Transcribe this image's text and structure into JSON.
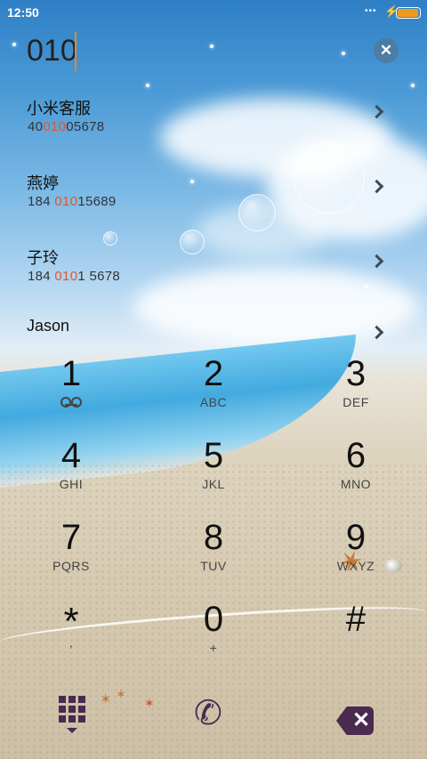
{
  "status_bar": {
    "time": "12:50",
    "signal_dots": "•••",
    "battery_level": 0.95,
    "battery_color": "#f09a1c"
  },
  "dialer": {
    "typed_number": "010",
    "clear_icon": "close-icon",
    "caret_color": "#e08a2a"
  },
  "results": [
    {
      "name": "小米客服",
      "number_pre": "40",
      "number_match": "010",
      "number_post": "05678"
    },
    {
      "name": "燕婷",
      "number_pre": "184 ",
      "number_match": "010",
      "number_post": "15689"
    },
    {
      "name": "子玲",
      "number_pre": "184 ",
      "number_match": "010",
      "number_post": "1 5678"
    },
    {
      "name": "Jason",
      "number_pre": "",
      "number_match": "",
      "number_post": ""
    }
  ],
  "keypad": [
    {
      "digit": "1",
      "letters": "",
      "icon": "voicemail-icon"
    },
    {
      "digit": "2",
      "letters": "ABC"
    },
    {
      "digit": "3",
      "letters": "DEF"
    },
    {
      "digit": "4",
      "letters": "GHI"
    },
    {
      "digit": "5",
      "letters": "JKL"
    },
    {
      "digit": "6",
      "letters": "MNO"
    },
    {
      "digit": "7",
      "letters": "PQRS"
    },
    {
      "digit": "8",
      "letters": "TUV"
    },
    {
      "digit": "9",
      "letters": "WXYZ"
    },
    {
      "digit": "*",
      "letters": ",",
      "icon": ""
    },
    {
      "digit": "0",
      "letters": "+"
    },
    {
      "digit": "#",
      "letters": ""
    }
  ],
  "actions": {
    "dialpad_toggle_icon": "dialpad-icon",
    "call_icon": "phone-icon",
    "call_glyph": "✆",
    "delete_icon": "backspace-icon",
    "delete_glyph": "✕",
    "accent_color": "#4a2a4e"
  },
  "colors": {
    "match_highlight": "#e0582a"
  }
}
